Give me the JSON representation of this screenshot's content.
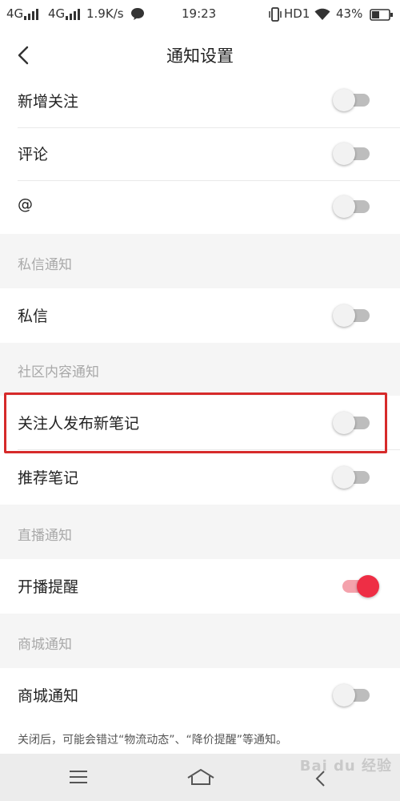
{
  "status_bar": {
    "signal1": "4G",
    "signal2": "4G",
    "speed": "1.9K/s",
    "time": "19:23",
    "hd": "HD1",
    "battery": "43%"
  },
  "header": {
    "title": "通知设置"
  },
  "rows": [
    {
      "label": "新增关注",
      "enabled": false
    },
    {
      "label": "评论",
      "enabled": false
    },
    {
      "label": "@",
      "enabled": false
    }
  ],
  "sections": {
    "private": {
      "header": "私信通知",
      "row": {
        "label": "私信",
        "enabled": false
      }
    },
    "community": {
      "header": "社区内容通知",
      "rows": [
        {
          "label": "关注人发布新笔记",
          "enabled": false
        },
        {
          "label": "推荐笔记",
          "enabled": false
        }
      ]
    },
    "live": {
      "header": "直播通知",
      "row": {
        "label": "开播提醒",
        "enabled": true
      }
    },
    "mall": {
      "header": "商城通知",
      "row": {
        "label": "商城通知",
        "enabled": false
      }
    }
  },
  "footer_note": "关闭后，可能会错过“物流动态”、“降价提醒”等通知。",
  "watermark": "Bai du 经验",
  "colors": {
    "accent": "#ee2e45",
    "highlight_border": "#d62a2a"
  }
}
